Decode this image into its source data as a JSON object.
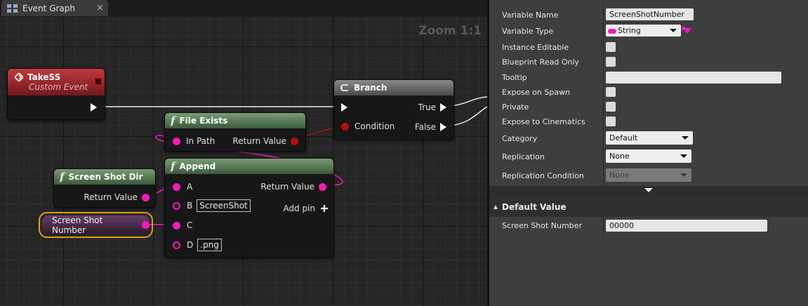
{
  "tab": {
    "label": "Event Graph",
    "close": "×"
  },
  "canvas": {
    "zoom_label": "Zoom 1:1"
  },
  "nodes": {
    "take_ss": {
      "title": "TakeSS",
      "subtitle": "Custom Event"
    },
    "branch": {
      "title": "Branch",
      "condition": "Condition",
      "true_label": "True",
      "false_label": "False"
    },
    "file_exists": {
      "title": "File Exists",
      "in_path": "In Path",
      "return_value": "Return Value"
    },
    "screenshot_dir": {
      "title": "Screen Shot Dir",
      "return_value": "Return Value"
    },
    "append": {
      "title": "Append",
      "a": "A",
      "b": "B",
      "b_value": "ScreenShot",
      "c": "C",
      "d": "D",
      "d_value": ".png",
      "return_value": "Return Value",
      "add_pin": "Add pin"
    },
    "var_getter": {
      "label": "Screen Shot Number"
    }
  },
  "details": {
    "variable_name": {
      "label": "Variable Name",
      "value": "ScreenShotNumber"
    },
    "variable_type": {
      "label": "Variable Type",
      "value": "String"
    },
    "instance_editable": {
      "label": "Instance Editable"
    },
    "blueprint_read_only": {
      "label": "Blueprint Read Only"
    },
    "tooltip": {
      "label": "Tooltip",
      "value": ""
    },
    "expose_on_spawn": {
      "label": "Expose on Spawn"
    },
    "private": {
      "label": "Private"
    },
    "expose_to_cinematics": {
      "label": "Expose to Cinematics"
    },
    "category": {
      "label": "Category",
      "value": "Default"
    },
    "replication": {
      "label": "Replication",
      "value": "None"
    },
    "replication_condition": {
      "label": "Replication Condition",
      "value": "None"
    },
    "default_value_section": "Default Value",
    "screen_shot_number": {
      "label": "Screen Shot Number",
      "value": "00000"
    }
  },
  "colors": {
    "string_pin": "#f21cbb",
    "bool_pin": "#b01014",
    "event_header": "#a8232a",
    "function_header": "#5b7a57",
    "selection_outline": "#e39a23"
  },
  "icons": [
    "blueprint-graph-icon",
    "close-icon",
    "event-icon",
    "branch-icon",
    "function-icon",
    "exec-pin-icon",
    "data-pin-icon",
    "add-pin-icon",
    "dropdown-arrow-icon",
    "expand-chevron-icon",
    "collapse-triangle-icon"
  ]
}
